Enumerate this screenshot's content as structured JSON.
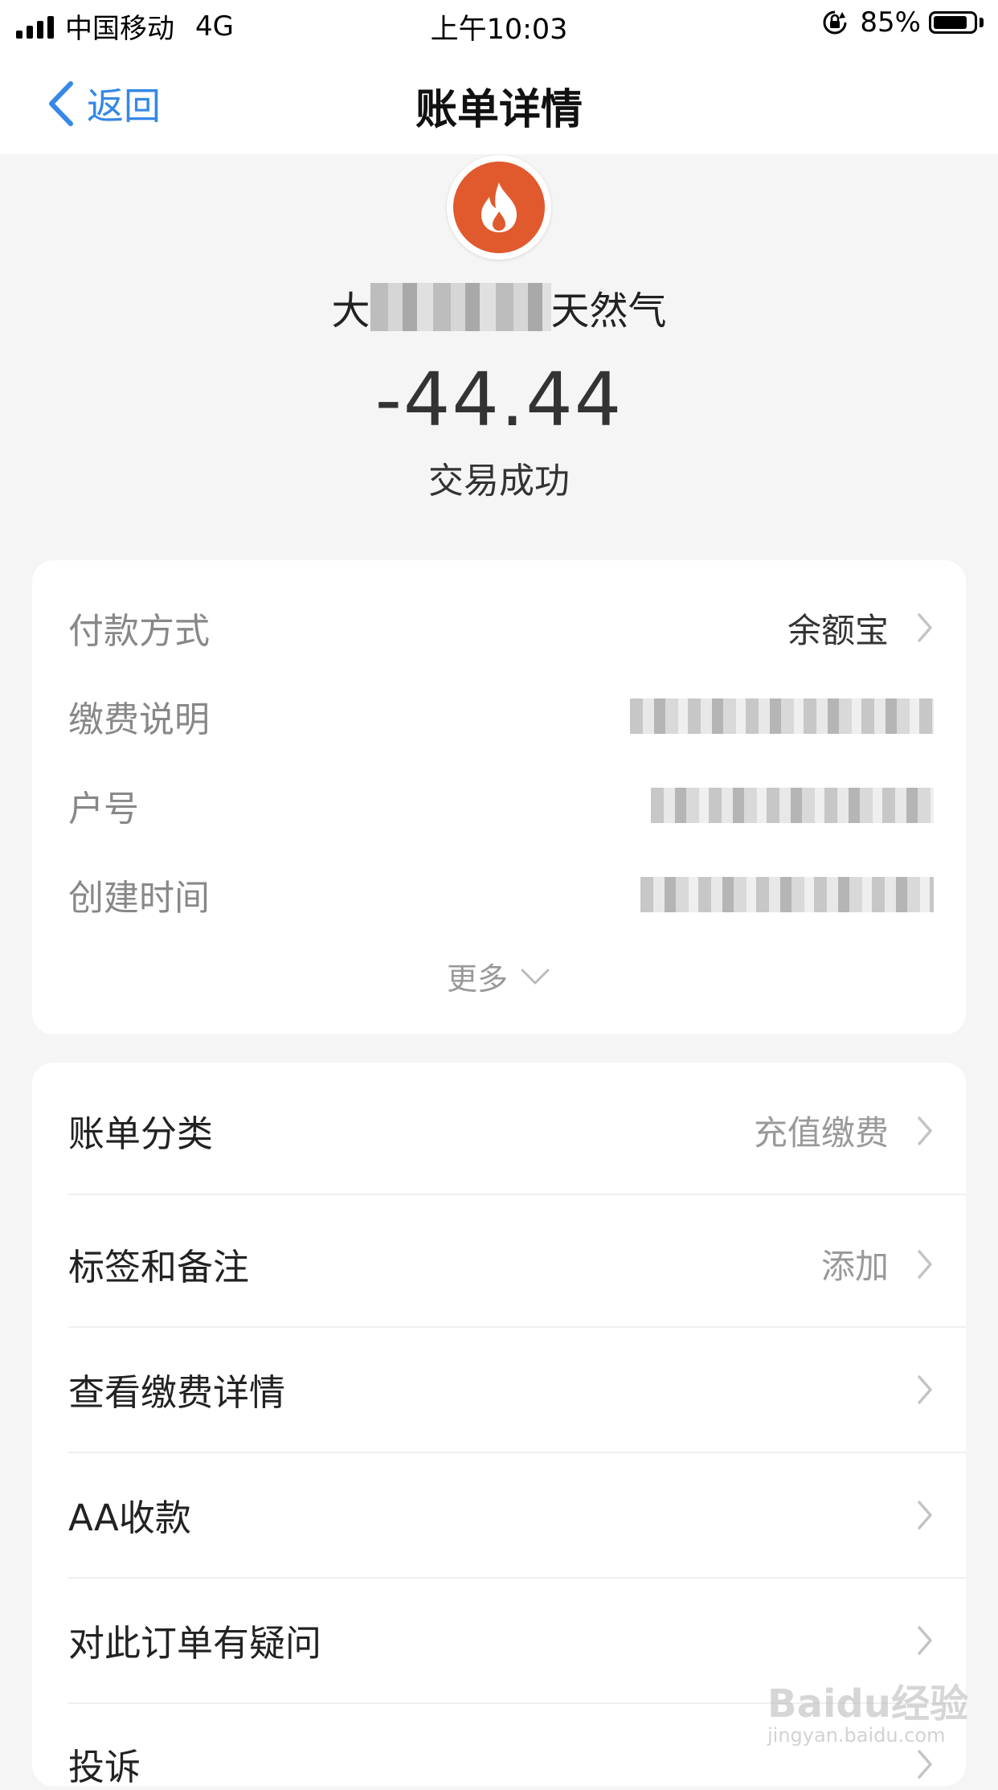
{
  "status_bar": {
    "carrier": "中国移动",
    "network": "4G",
    "time": "上午10:03",
    "battery": "85%",
    "battery_level": 0.85
  },
  "nav": {
    "back_label": "返回",
    "title": "账单详情"
  },
  "header": {
    "logo_icon": "flame-icon",
    "merchant_name_prefix": "大",
    "merchant_name_suffix": "天然气",
    "amount": "-44.44",
    "status": "交易成功"
  },
  "details": {
    "rows": [
      {
        "label": "付款方式",
        "value": "余额宝"
      },
      {
        "label": "缴费说明",
        "value": ""
      },
      {
        "label": "户号",
        "value": ""
      },
      {
        "label": "创建时间",
        "value": ""
      }
    ],
    "more_label": "更多"
  },
  "actions": {
    "items": [
      {
        "label": "账单分类",
        "value": "充值缴费"
      },
      {
        "label": "标签和备注",
        "value": "添加"
      },
      {
        "label": "查看缴费详情",
        "value": ""
      },
      {
        "label": "AA收款",
        "value": ""
      },
      {
        "label": "对此订单有疑问",
        "value": ""
      },
      {
        "label": "投诉",
        "value": ""
      }
    ]
  },
  "watermark": {
    "brand": "Baidu经验",
    "url": "jingyan.baidu.com"
  },
  "colors": {
    "accent": "#3688e6",
    "logo_bg": "#e05a2e",
    "page_bg": "#f5f5f5"
  }
}
